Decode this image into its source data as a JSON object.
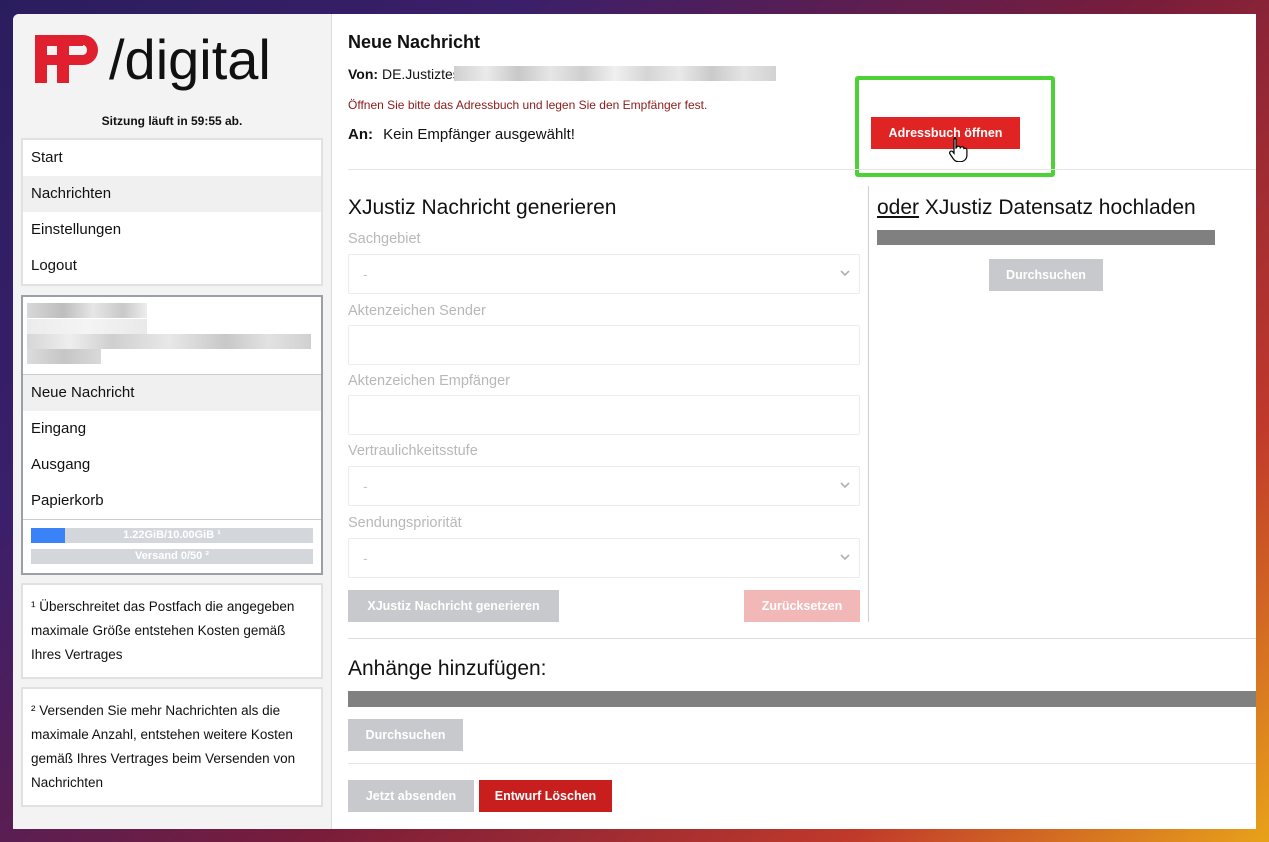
{
  "logo": {
    "brand_red": "#e0202e",
    "text": "/digital",
    "mark": "FP"
  },
  "session": "Sitzung läuft in 59:55 ab.",
  "nav": [
    {
      "label": "Start"
    },
    {
      "label": "Nachrichten"
    },
    {
      "label": "Einstellungen"
    },
    {
      "label": "Logout"
    }
  ],
  "mailbox": {
    "items": [
      {
        "label": "Neue Nachricht"
      },
      {
        "label": "Eingang"
      },
      {
        "label": "Ausgang"
      },
      {
        "label": "Papierkorb"
      }
    ],
    "storage_label": "1.22GiB/10.00GiB ¹",
    "storage_fraction": 0.122,
    "send_label": "Versand 0/50 ²",
    "send_fraction": 0.0
  },
  "notes": {
    "note1": "¹ Überschreitet das Postfach die angegeben maximale Größe entstehen Kosten gemäß Ihres Vertrages",
    "note2": "² Versenden Sie mehr Nachrichten als die maximale Anzahl, entstehen weitere Kosten gemäß Ihres Vertrages beim Versenden von Nachrichten"
  },
  "compose": {
    "title": "Neue Nachricht",
    "from_label": "Von:",
    "from_value": "DE.Justiztest",
    "hint": "Öffnen Sie bitte das Adressbuch und legen Sie den Empfänger fest.",
    "to_label": "An:",
    "to_value": "Kein Empfänger ausgewählt!",
    "addressbook_button": "Adressbuch öffnen"
  },
  "xjustiz": {
    "heading": "XJustiz Nachricht generieren",
    "fields": {
      "sachgebiet_label": "Sachgebiet",
      "sachgebiet_value": "-",
      "az_sender_label": "Aktenzeichen Sender",
      "az_empf_label": "Aktenzeichen Empfänger",
      "vertraulich_label": "Vertraulichkeitsstufe",
      "vertraulich_value": "-",
      "prio_label": "Sendungspriorität",
      "prio_value": "-"
    },
    "generate_button": "XJustiz Nachricht generieren",
    "reset_button": "Zurücksetzen"
  },
  "upload": {
    "heading_or": "oder",
    "heading_rest": " XJustiz Datensatz hochladen",
    "browse_button": "Durchsuchen"
  },
  "attachments": {
    "heading": "Anhänge hinzufügen:",
    "browse_button": "Durchsuchen"
  },
  "footer": {
    "send_button": "Jetzt absenden",
    "delete_button": "Entwurf Löschen"
  }
}
